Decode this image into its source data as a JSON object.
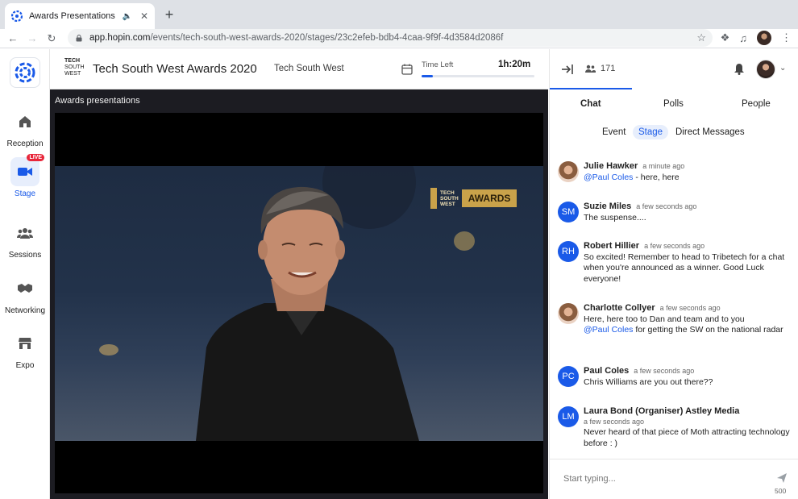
{
  "browser": {
    "tab_title": "Awards Presentations",
    "url_host": "app.hopin.com",
    "url_path": "/events/tech-south-west-awards-2020/stages/23c2efeb-bdb4-4caa-9f9f-4d3584d2086f",
    "new_tab_label": "+"
  },
  "rail": {
    "items": [
      {
        "label": "Reception",
        "icon": "home-icon"
      },
      {
        "label": "Stage",
        "icon": "video-camera-icon",
        "badge": "LIVE",
        "active": true
      },
      {
        "label": "Sessions",
        "icon": "people-group-icon"
      },
      {
        "label": "Networking",
        "icon": "handshake-icon"
      },
      {
        "label": "Expo",
        "icon": "store-icon"
      }
    ]
  },
  "event": {
    "logo_lines": [
      "TECH",
      "SOUTH",
      "WEST"
    ],
    "title": "Tech South West Awards 2020",
    "organiser": "Tech South West",
    "time_left_label": "Time Left",
    "time_left_value": "1h:20m",
    "time_progress": 0.1
  },
  "stage": {
    "title": "Awards presentations",
    "sign_lines": [
      "TECH",
      "SOUTH",
      "WEST"
    ],
    "sign_word": "AWARDS"
  },
  "panel": {
    "attendee_count": "171",
    "tabs": [
      "Chat",
      "Polls",
      "People"
    ],
    "subtabs": [
      "Event",
      "Stage",
      "Direct Messages"
    ],
    "messages": [
      {
        "avatar": "photo",
        "initials": "",
        "name": "Julie Hawker",
        "time": "a minute ago",
        "mention": "@Paul Coles",
        "text": " - here, here",
        "color": "#1a5ae8"
      },
      {
        "avatar": "initials",
        "initials": "SM",
        "name": "Suzie Miles",
        "time": "a few seconds ago",
        "mention": "",
        "text": "The suspense....",
        "color": "#1a5ae8"
      },
      {
        "avatar": "initials",
        "initials": "RH",
        "name": "Robert Hillier",
        "time": "a few seconds ago",
        "mention": "",
        "text": "So excited! Remember to head to Tribetech for a chat when you're announced as a winner. Good Luck everyone!",
        "color": "#1a5ae8"
      },
      {
        "avatar": "photo",
        "initials": "",
        "name": "Charlotte Collyer",
        "time": "a few seconds ago",
        "mention": "",
        "text": "Here, here too to Dan and team and to you",
        "mention2": "@Paul Coles",
        "text2": " for getting the SW on the national radar",
        "color": "#1a5ae8"
      },
      {
        "avatar": "initials",
        "initials": "PC",
        "name": "Paul Coles",
        "time": "a few seconds ago",
        "mention": "",
        "text": "Chris Williams are you out there??",
        "color": "#1a5ae8"
      },
      {
        "avatar": "initials",
        "initials": "LM",
        "name": "Laura Bond (Organiser) Astley Media",
        "time": "a few seconds ago",
        "mention": "",
        "text": "Never heard of that piece of Moth attracting technology before : )",
        "color": "#1a5ae8"
      }
    ],
    "input_placeholder": "Start typing...",
    "char_limit": "500"
  },
  "colors": {
    "accent": "#1a5ae8",
    "live": "#e8263a",
    "stage_bg": "#1c1c22"
  }
}
